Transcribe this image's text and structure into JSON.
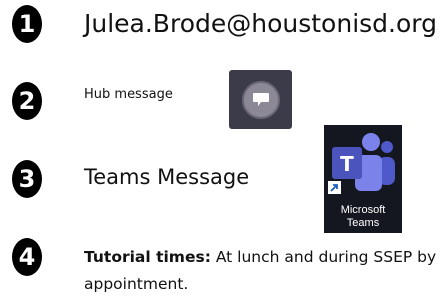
{
  "items": [
    {
      "number": "1",
      "text": "Julea.Brode@houstonisd.org"
    },
    {
      "number": "2",
      "text": "Hub message"
    },
    {
      "number": "3",
      "text": "Teams Message"
    },
    {
      "number": "4",
      "bold": "Tutorial times:",
      "text": " At lunch and during SSEP by appointment."
    }
  ],
  "icons": {
    "hub": "chat-bubble-icon",
    "teams": "microsoft-teams-icon"
  },
  "teams_icon": {
    "line1": "Microsoft",
    "line2": "Teams"
  },
  "colors": {
    "badge": "#000000",
    "hub_tile": "#3b3b49",
    "teams_tile": "#14171f",
    "teams_purple": "#5059c9"
  }
}
